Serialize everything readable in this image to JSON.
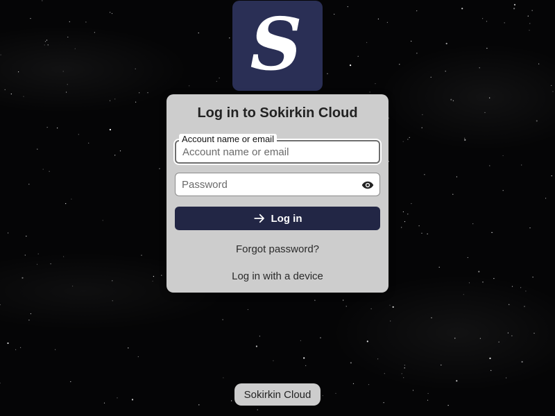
{
  "app": {
    "logo_letter": "S",
    "brand_color": "#2a2f55"
  },
  "login": {
    "title": "Log in to Sokirkin Cloud",
    "account_label": "Account name or email",
    "account_placeholder": "Account name or email",
    "account_value": "",
    "password_placeholder": "Password",
    "password_value": "",
    "show_password_icon": "eye-icon",
    "login_icon": "arrow-right-icon",
    "login_button": "Log in",
    "forgot_password": "Forgot password?",
    "device_login": "Log in with a device",
    "button_color": "#222645"
  },
  "footer": {
    "label": "Sokirkin Cloud"
  }
}
